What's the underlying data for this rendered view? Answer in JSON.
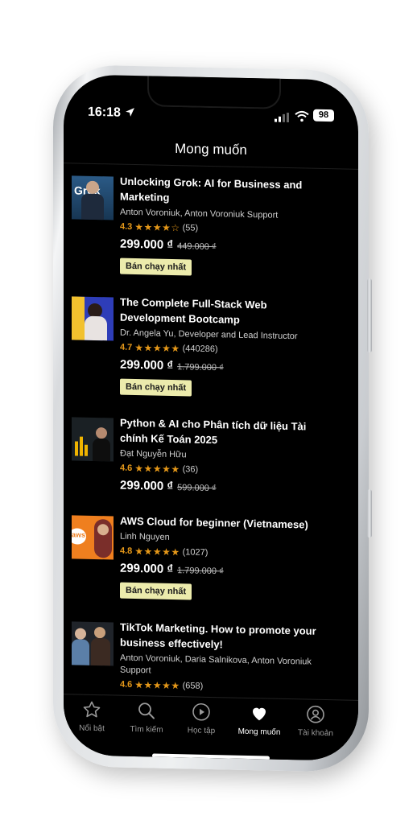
{
  "status": {
    "time": "16:18",
    "battery": "98"
  },
  "header": {
    "title": "Mong muốn"
  },
  "courses": [
    {
      "title": "Unlocking Grok: AI for Business and Marketing",
      "instructor": "Anton Voroniuk, Anton Voroniuk Support",
      "rating": "4.3",
      "stars": "★★★★☆",
      "count": "(55)",
      "price": "299.000 ₫",
      "old_price": "449.000 ₫",
      "badge": "Bán chạy nhất",
      "thumb_text": "Grok"
    },
    {
      "title": "The Complete Full-Stack Web Development Bootcamp",
      "instructor": "Dr. Angela Yu, Developer and Lead Instructor",
      "rating": "4.7",
      "stars": "★★★★★",
      "count": "(440286)",
      "price": "299.000 ₫",
      "old_price": "1.799.000 ₫",
      "badge": "Bán chạy nhất"
    },
    {
      "title": "Python & AI cho Phân tích dữ liệu Tài chính Kế Toán 2025",
      "instructor": "Đạt Nguyễn Hữu",
      "rating": "4.6",
      "stars": "★★★★★",
      "count": "(36)",
      "price": "299.000 ₫",
      "old_price": "599.000 ₫"
    },
    {
      "title": "AWS Cloud for beginner (Vietnamese)",
      "instructor": "Linh Nguyen",
      "rating": "4.8",
      "stars": "★★★★★",
      "count": "(1027)",
      "price": "299.000 ₫",
      "old_price": "1.799.000 ₫",
      "badge": "Bán chạy nhất",
      "thumb_text": "aws"
    },
    {
      "title": "TikTok Marketing. How to promote your business effectively!",
      "instructor": "Anton Voroniuk, Daria Salnikova, Anton Voroniuk Support",
      "rating": "4.6",
      "stars": "★★★★★",
      "count": "(658)"
    }
  ],
  "tabs": [
    {
      "label": "Nổi bật",
      "icon": "star-icon"
    },
    {
      "label": "Tìm kiếm",
      "icon": "search-icon"
    },
    {
      "label": "Học tập",
      "icon": "play-icon"
    },
    {
      "label": "Mong muốn",
      "icon": "heart-icon",
      "active": true
    },
    {
      "label": "Tài khoản",
      "icon": "user-icon"
    }
  ],
  "colors": {
    "accent": "#e59819",
    "badge": "#ecebac",
    "background": "#000000"
  }
}
